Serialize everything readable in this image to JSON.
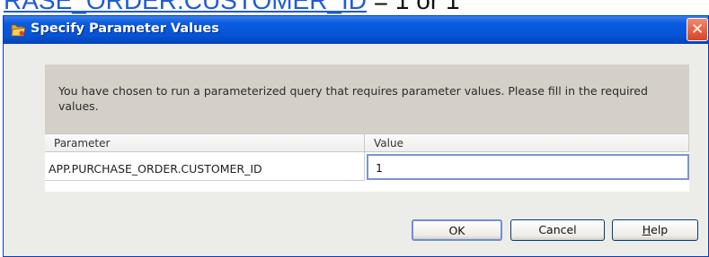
{
  "background": {
    "link_text": "RASE_ORDER.CUSTOMER_ID",
    "rest_text": " = 1 or 1"
  },
  "dialog": {
    "title": "Specify Parameter Values",
    "close_glyph": "✕",
    "message": "You have chosen to run a parameterized query that requires parameter values. Please fill in the required values.",
    "table": {
      "headers": [
        "Parameter",
        "Value"
      ],
      "rows": [
        {
          "parameter": "APP.PURCHASE_ORDER.CUSTOMER_ID",
          "value": "1"
        }
      ]
    },
    "buttons": {
      "ok": "OK",
      "cancel": "Cancel",
      "help_mnemonic": "H",
      "help_rest": "elp"
    }
  },
  "icons": {
    "title": "folder-icon",
    "close": "close-icon"
  },
  "colors": {
    "titlebar": "#0553d7",
    "close_button": "#d94322",
    "dialog_bg": "#ecece8",
    "message_bg": "#d4d0c8",
    "focus_border": "#7a96c8"
  }
}
